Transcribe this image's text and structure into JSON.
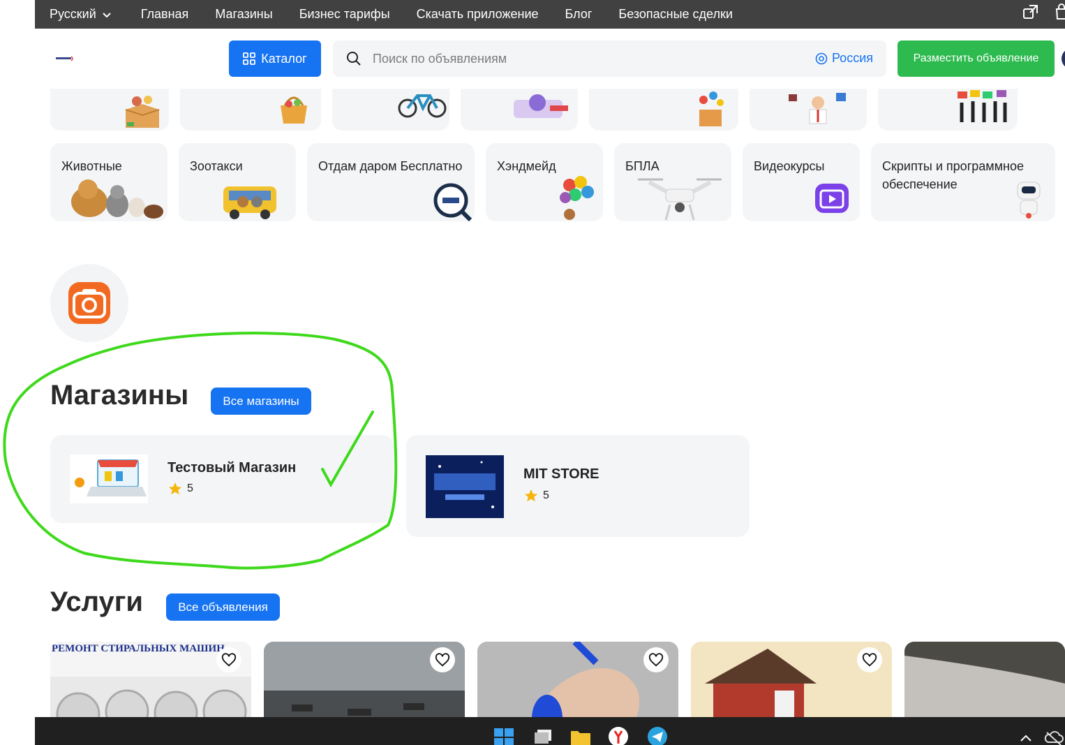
{
  "topbar": {
    "language": "Русский",
    "nav": [
      "Главная",
      "Магазины",
      "Бизнес тарифы",
      "Скачать приложение",
      "Блог",
      "Безопасные сделки"
    ],
    "icons": [
      "chevron-down-icon",
      "external-window-icon",
      "cart-icon"
    ]
  },
  "header": {
    "catalog_label": "Каталог",
    "search_placeholder": "Поиск по объявлениям",
    "region": "Россия",
    "post_label": "Разместить объявление"
  },
  "categories": [
    {
      "label": "Животные",
      "icon": "animals-image"
    },
    {
      "label": "Зоотакси",
      "icon": "pet-taxi-image"
    },
    {
      "label": "Отдам даром Бесплатно",
      "icon": "free-giveaway-image"
    },
    {
      "label": "Хэндмейд",
      "icon": "balloons-image"
    },
    {
      "label": "БПЛА",
      "icon": "drone-image"
    },
    {
      "label": "Видеокурсы",
      "icon": "video-course-image"
    },
    {
      "label": "Скрипты и программное обеспечение",
      "icon": "robot-image"
    }
  ],
  "shops": {
    "title": "Магазины",
    "all_label": "Все магазины",
    "items": [
      {
        "name": "Тестовый Магазин",
        "rating": "5"
      },
      {
        "name": "MIT STORE",
        "rating": "5"
      }
    ]
  },
  "services": {
    "title": "Услуги",
    "all_label": "Все объявления",
    "first_banner_text": "РЕМОНТ СТИРАЛЬНЫХ МАШИН"
  },
  "colors": {
    "primary": "#1673f2",
    "success": "#2dba4e",
    "topbar": "#414141",
    "annotation": "#3fd91c",
    "star": "#f5b50a"
  }
}
